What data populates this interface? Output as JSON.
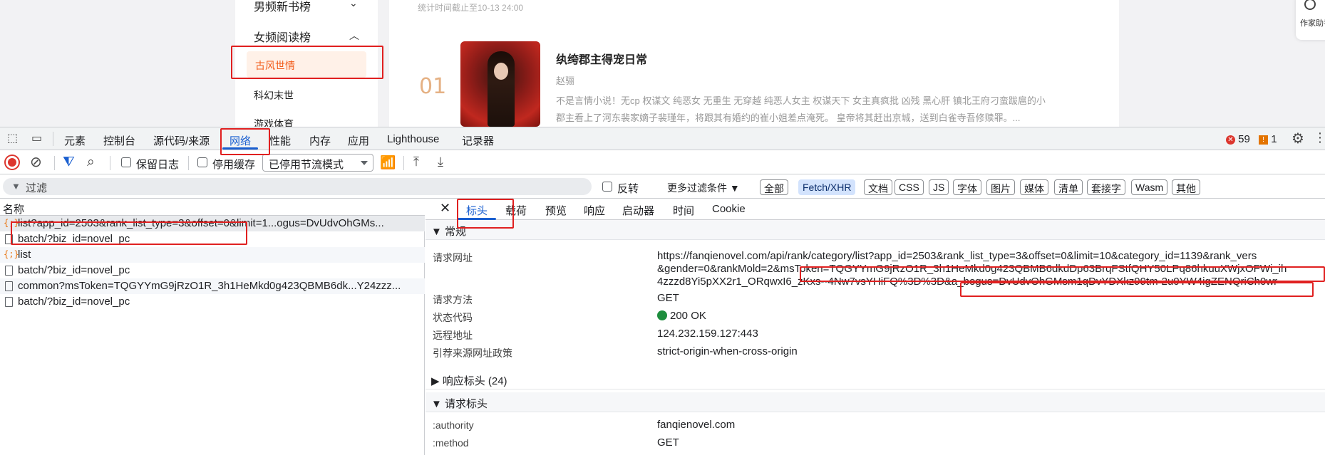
{
  "webpage": {
    "sidebar": {
      "item_top": "男频新书榜",
      "section": "女频阅读榜",
      "active_item": "古风世情",
      "item_next": "科幻末世",
      "item_cut": "游戏体育"
    },
    "stat_time": "统计时间截止至10-13 24:00",
    "book": {
      "rank": "01",
      "title": "纨绔郡主得宠日常",
      "author": "赵骊",
      "desc_line1": "不是言情小说！无cp 权谋文 纯恶女 无重生 无穿越 纯恶人女主 权谋天下 女主真疯批 凶残 黑心肝 镇北王府刁蛮跋扈的小",
      "desc_line2": "郡主看上了河东裴家嫡子裴瑾年，将跟其有婚约的崔小姐差点淹死。 皇帝将其赶出京城，送到白雀寺吾修赎罪。..."
    },
    "right_widget": "作家助手"
  },
  "devtools": {
    "tabs": [
      "元素",
      "控制台",
      "源代码/来源",
      "网络",
      "性能",
      "内存",
      "应用",
      "Lighthouse",
      "记录器"
    ],
    "active_tab": "网络",
    "errors": "59",
    "warnings": "1",
    "toolbar": {
      "preserve_log": "保留日志",
      "disable_cache": "停用缓存",
      "throttle": "已停用节流模式"
    },
    "filter": {
      "placeholder": "过滤",
      "invert": "反转",
      "more_filters": "更多过滤条件 ▼",
      "chips": [
        "全部",
        "Fetch/XHR",
        "文档",
        "CSS",
        "JS",
        "字体",
        "图片",
        "媒体",
        "清单",
        "套接字",
        "Wasm",
        "其他"
      ],
      "selected_chip": "Fetch/XHR"
    },
    "request_list": {
      "header": "名称",
      "rows": [
        {
          "type": "xhr",
          "name": "list?app_id=2503&rank_list_type=3&offset=0&limit=1...ogus=DvUdvOhGMs..."
        },
        {
          "type": "doc",
          "name": "batch/?biz_id=novel_pc"
        },
        {
          "type": "xhr",
          "name": "list"
        },
        {
          "type": "doc",
          "name": "batch/?biz_id=novel_pc"
        },
        {
          "type": "doc",
          "name": "common?msToken=TQGYYmG9jRzO1R_3h1HeMkd0g423QBMB6dk...Y24zzz..."
        },
        {
          "type": "doc",
          "name": "batch/?biz_id=novel_pc"
        }
      ]
    },
    "detail": {
      "tabs": [
        "标头",
        "载荷",
        "预览",
        "响应",
        "启动器",
        "时间",
        "Cookie"
      ],
      "active_tab": "标头",
      "general_section": "▼ 常规",
      "rows": {
        "url_key": "请求网址",
        "url_line1": "https://fanqienovel.com/api/rank/category/list?app_id=2503&rank_list_type=3&offset=0&limit=10&category_id=1139&rank_vers",
        "url_line2": "&gender=0&rankMold=2&msToken=TQGYYmG9jRzO1R_3h1HeMkd0g423QBMB6dkdDp63BrqFStfQHY50LPq86hkuuXWjxOFWi_ih",
        "url_line3": "4zzzd8Yi5pXX2r1_ORqwxI6_zKxs--4Nw7vsYHiFQ%3D%3D&a_bogus=DvUdvOhGMsm1qDvYDXkz99tm-2u0YW4igZENQriCh0wr",
        "method_key": "请求方法",
        "method_val": "GET",
        "status_key": "状态代码",
        "status_val": "200 OK",
        "remote_key": "远程地址",
        "remote_val": "124.232.159.127:443",
        "referrer_key": "引荐来源网址政策",
        "referrer_val": "strict-origin-when-cross-origin"
      },
      "response_headers_section": "▶ 响应标头 (24)",
      "request_headers_section": "▼ 请求标头",
      "req_headers": [
        {
          "key": ":authority",
          "val": "fanqienovel.com"
        },
        {
          "key": ":method",
          "val": "GET"
        }
      ]
    },
    "status_color": "#1e8e3e",
    "accent_color": "#1a5fd0"
  }
}
